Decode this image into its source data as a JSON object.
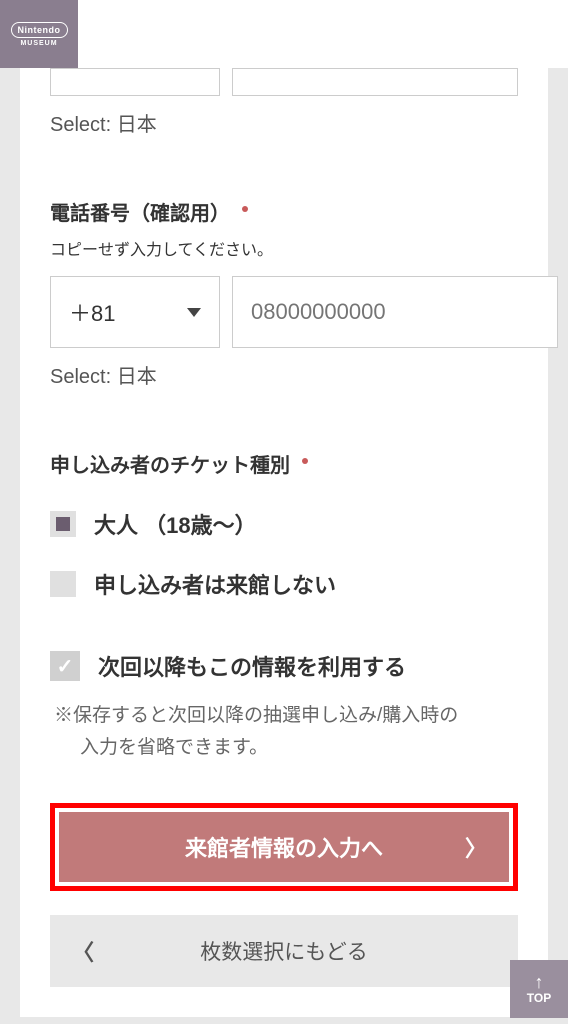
{
  "header": {
    "logo_top": "Nintendo",
    "logo_bottom": "MUSEUM"
  },
  "phone_prev": {
    "select_label": "Select: 日本"
  },
  "phone_confirm": {
    "title": "電話番号（確認用）",
    "hint": "コピーせず入力してください。",
    "country_code": "＋81",
    "placeholder": "08000000000",
    "select_label": "Select: 日本"
  },
  "ticket_type": {
    "title": "申し込み者のチケット種別",
    "options": [
      {
        "label": "大人 （18歳〜）",
        "selected": true
      },
      {
        "label": "申し込み者は来館しない",
        "selected": false
      }
    ]
  },
  "save_info": {
    "label": "次回以降もこの情報を利用する",
    "note_line1": "※保存すると次回以降の抽選申し込み/購入時の",
    "note_line2": "入力を省略できます。"
  },
  "buttons": {
    "primary": "来館者情報の入力へ",
    "secondary": "枚数選択にもどる",
    "top": "TOP"
  }
}
